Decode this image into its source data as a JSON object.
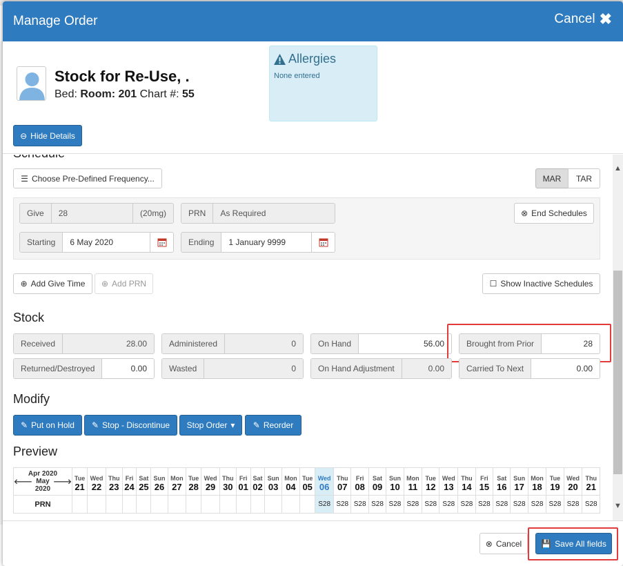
{
  "header": {
    "title": "Manage Order",
    "cancel_label": "Cancel"
  },
  "patient": {
    "name": "Stock for Re-Use, .",
    "bed_label": "Bed:",
    "room": "Room: 201",
    "chart_label": "Chart #:",
    "chart_number": "55"
  },
  "allergies": {
    "title": "Allergies",
    "value": "None entered"
  },
  "buttons": {
    "hide_details": "Hide Details"
  },
  "schedule": {
    "section_label": "Schedule",
    "predefined_label": "Choose Pre-Defined Frequency...",
    "mar_label": "MAR",
    "tar_label": "TAR",
    "give_label": "Give",
    "give_value": "28",
    "give_unit": "(20mg)",
    "prn_label": "PRN",
    "prn_value": "As Required",
    "end_schedules_label": "End Schedules",
    "starting_label": "Starting",
    "starting_value": "6 May 2020",
    "ending_label": "Ending",
    "ending_value": "1 January 9999",
    "add_give_time_label": "Add Give Time",
    "add_prn_label": "Add PRN",
    "show_inactive_label": "Show Inactive Schedules"
  },
  "stock": {
    "title": "Stock",
    "received_label": "Received",
    "received_value": "28.00",
    "administered_label": "Administered",
    "administered_value": "0",
    "on_hand_label": "On Hand",
    "on_hand_value": "56.00",
    "brought_label": "Brought from Prior",
    "brought_value": "28",
    "returned_label": "Returned/Destroyed",
    "returned_value": "0.00",
    "wasted_label": "Wasted",
    "wasted_value": "0",
    "adjust_label": "On Hand Adjustment",
    "adjust_value": "0.00",
    "carried_label": "Carried To Next",
    "carried_value": "0.00"
  },
  "modify": {
    "title": "Modify",
    "hold_label": "Put on Hold",
    "stop_disc_label": "Stop - Discontinue",
    "stop_order_label": "Stop Order",
    "reorder_label": "Reorder"
  },
  "preview": {
    "title": "Preview",
    "prev_month": "Apr 2020",
    "cur_month": "May 2020",
    "row_label": "PRN",
    "days": [
      {
        "d": "Tue",
        "n": "21",
        "v": ""
      },
      {
        "d": "Wed",
        "n": "22",
        "v": ""
      },
      {
        "d": "Thu",
        "n": "23",
        "v": ""
      },
      {
        "d": "Fri",
        "n": "24",
        "v": ""
      },
      {
        "d": "Sat",
        "n": "25",
        "v": ""
      },
      {
        "d": "Sun",
        "n": "26",
        "v": ""
      },
      {
        "d": "Mon",
        "n": "27",
        "v": ""
      },
      {
        "d": "Tue",
        "n": "28",
        "v": ""
      },
      {
        "d": "Wed",
        "n": "29",
        "v": ""
      },
      {
        "d": "Thu",
        "n": "30",
        "v": ""
      },
      {
        "d": "Fri",
        "n": "01",
        "v": ""
      },
      {
        "d": "Sat",
        "n": "02",
        "v": ""
      },
      {
        "d": "Sun",
        "n": "03",
        "v": ""
      },
      {
        "d": "Mon",
        "n": "04",
        "v": ""
      },
      {
        "d": "Tue",
        "n": "05",
        "v": ""
      },
      {
        "d": "Wed",
        "n": "06",
        "v": "S28",
        "today": true
      },
      {
        "d": "Thu",
        "n": "07",
        "v": "S28"
      },
      {
        "d": "Fri",
        "n": "08",
        "v": "S28"
      },
      {
        "d": "Sat",
        "n": "09",
        "v": "S28"
      },
      {
        "d": "Sun",
        "n": "10",
        "v": "S28"
      },
      {
        "d": "Mon",
        "n": "11",
        "v": "S28"
      },
      {
        "d": "Tue",
        "n": "12",
        "v": "S28"
      },
      {
        "d": "Wed",
        "n": "13",
        "v": "S28"
      },
      {
        "d": "Thu",
        "n": "14",
        "v": "S28"
      },
      {
        "d": "Fri",
        "n": "15",
        "v": "S28"
      },
      {
        "d": "Sat",
        "n": "16",
        "v": "S28"
      },
      {
        "d": "Sun",
        "n": "17",
        "v": "S28"
      },
      {
        "d": "Mon",
        "n": "18",
        "v": "S28"
      },
      {
        "d": "Tue",
        "n": "19",
        "v": "S28"
      },
      {
        "d": "Wed",
        "n": "20",
        "v": "S28"
      },
      {
        "d": "Thu",
        "n": "21",
        "v": "S28"
      }
    ]
  },
  "footer": {
    "cancel_label": "Cancel",
    "save_label": "Save All fields"
  }
}
